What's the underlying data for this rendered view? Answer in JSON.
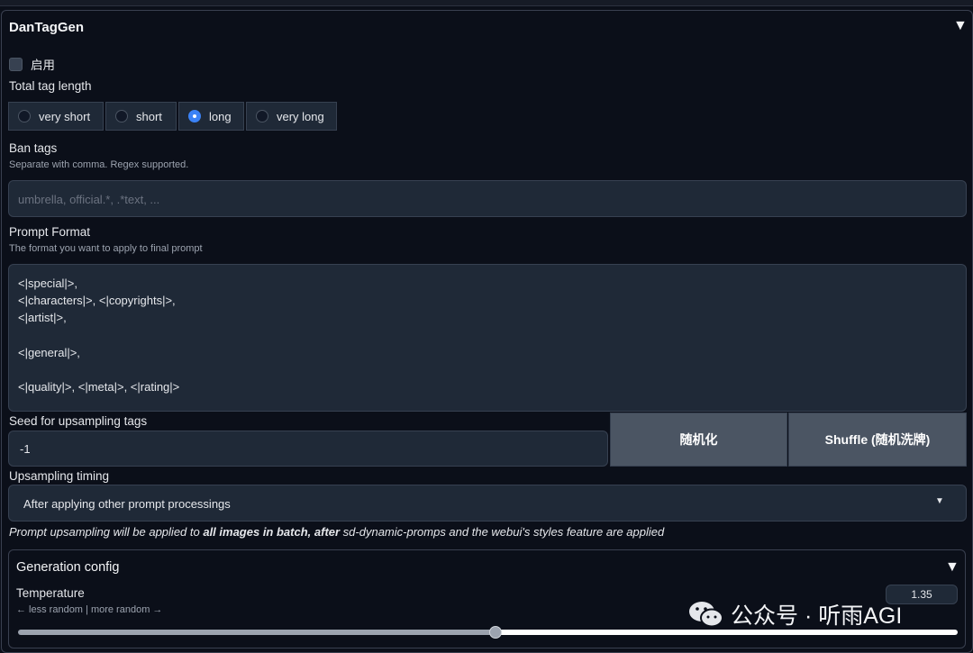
{
  "header": {
    "title": "DanTagGen"
  },
  "enable": {
    "label": "启用",
    "checked": false
  },
  "tag_length": {
    "label": "Total tag length",
    "options": [
      "very short",
      "short",
      "long",
      "very long"
    ],
    "selected": "long"
  },
  "ban_tags": {
    "label": "Ban tags",
    "hint": "Separate with comma. Regex supported.",
    "placeholder": "umbrella, official.*, .*text, ...",
    "value": ""
  },
  "prompt_format": {
    "label": "Prompt Format",
    "hint": "The format you want to apply to final prompt",
    "value": "<|special|>,\n<|characters|>, <|copyrights|>,\n<|artist|>,\n\n<|general|>,\n\n<|quality|>, <|meta|>, <|rating|>"
  },
  "seed": {
    "label": "Seed for upsampling tags",
    "value": "-1",
    "randomize_label": "随机化",
    "shuffle_label": "Shuffle (随机洗牌)"
  },
  "timing": {
    "label": "Upsampling timing",
    "selected": "After applying other prompt processings",
    "note_prefix": "Prompt upsampling will be applied to ",
    "note_bold1": "all images in batch, after",
    "note_suffix": " sd-dynamic-promps and the webui's styles feature are applied"
  },
  "generation": {
    "title": "Generation config",
    "temperature_label": "Temperature",
    "temperature_hint": "← less random | more random →",
    "temperature_value": "1.35",
    "temperature_fraction": 0.508
  },
  "watermark": {
    "text": "公众号 · 听雨AGI"
  },
  "icons": {
    "collapse": "triangle-down-icon",
    "dropdown": "caret-down-icon",
    "wechat": "wechat-icon"
  }
}
